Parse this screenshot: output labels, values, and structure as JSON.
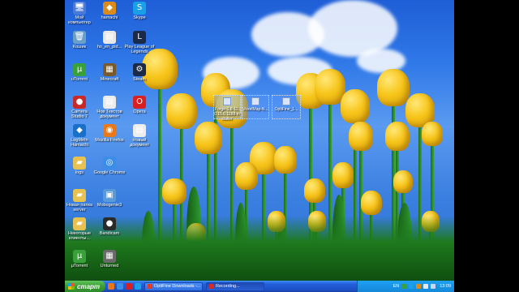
{
  "desktop": {
    "icons": [
      {
        "label": "Мой\nкомпьютер",
        "glyph": "🖥",
        "color": "#4a7ad8"
      },
      {
        "label": "hamachi",
        "glyph": "◆",
        "color": "#d98c1a"
      },
      {
        "label": "Skype",
        "glyph": "S",
        "color": "#1aa0e8"
      },
      {
        "label": "Кошик",
        "glyph": "🗑",
        "color": "#6aa0c8"
      },
      {
        "label": "ho_en_pid...",
        "glyph": "▤",
        "color": "#e8e8e8"
      },
      {
        "label": "Play League of\nLegends",
        "glyph": "L",
        "color": "#1a2a48"
      },
      {
        "label": "uTorrent",
        "glyph": "µ",
        "color": "#3aa03a"
      },
      {
        "label": "Minecraft",
        "glyph": "▦",
        "color": "#7a5a2a"
      },
      {
        "label": "Steam",
        "glyph": "⚙",
        "color": "#1a2a48"
      },
      {
        "label": "Camera\nStudio 7",
        "glyph": "●",
        "color": "#c82828"
      },
      {
        "label": "Нов Текстов\nдокумент",
        "glyph": "▤",
        "color": "#ececec"
      },
      {
        "label": "Opera",
        "glyph": "O",
        "color": "#d82020"
      },
      {
        "label": "LogMeIn\nHamachi",
        "glyph": "◆",
        "color": "#1a70c8"
      },
      {
        "label": "Mozilla Firefox",
        "glyph": "◉",
        "color": "#e8781a"
      },
      {
        "label": "Новый\nдокумент",
        "glyph": "▤",
        "color": "#ececec"
      },
      {
        "label": "logs",
        "glyph": "▰",
        "color": "#e8c250"
      },
      {
        "label": "Google Chrome",
        "glyph": "◎",
        "color": "#3a8ee8"
      },
      {
        "label": "Новая папка\nserver",
        "glyph": "▰",
        "color": "#e8c250"
      },
      {
        "label": "Mobogenie3",
        "glyph": "▣",
        "color": "#5a9ad8"
      },
      {
        "label": "Некоторые\nклиенты...",
        "glyph": "▰",
        "color": "#e8c250"
      },
      {
        "label": "Bandicam",
        "glyph": "●",
        "color": "#2a2a2a"
      },
      {
        "label": "µTorrent",
        "glyph": "µ",
        "color": "#3aa03a"
      },
      {
        "label": "Unturned",
        "glyph": "▦",
        "color": "#6a6a6a"
      }
    ],
    "selected": [
      {
        "label": "Forge-1.8-11.\n0.15.0.1188-in\nstaller"
      },
      {
        "label": "VoxelMap-N..."
      },
      {
        "label": "OptiFine_1..."
      }
    ]
  },
  "taskbar": {
    "start_label": "старт",
    "tasks": [
      {
        "label": "OptiFine Downloads -...",
        "icon_color": "#e33a2a",
        "active": false
      },
      {
        "label": "Recording...",
        "icon_color": "#d82828",
        "active": true
      }
    ],
    "tray": {
      "language": "EN",
      "clock": "13:09"
    }
  },
  "colors": {
    "taskbar": "#245edb",
    "start": "#3a9c35",
    "tray": "#1587d8"
  }
}
